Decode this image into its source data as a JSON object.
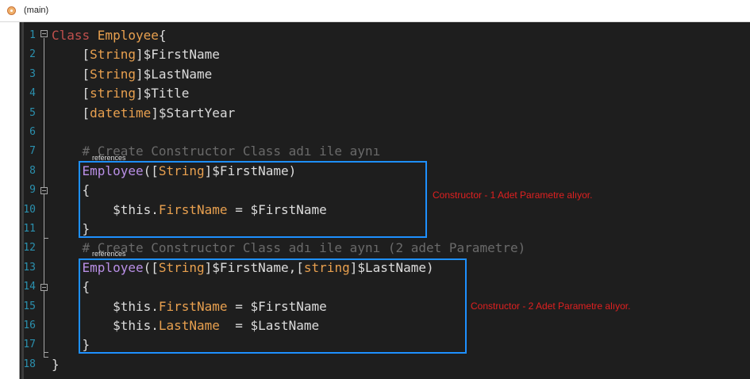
{
  "tab": {
    "icon": "powershell-script-icon",
    "label": "(main)"
  },
  "references_label": "references",
  "annotations": [
    {
      "text": "Constructor  - 1 Adet Parametre alıyor.",
      "color": "#e02020"
    },
    {
      "text": "Constructor  - 2 Adet Parametre alıyor.",
      "color": "#e02020"
    }
  ],
  "highlight_color": "#1e90ff",
  "lines": [
    {
      "n": "1",
      "tokens": [
        {
          "t": "Class ",
          "c": "kw"
        },
        {
          "t": "Employee",
          "c": "cls"
        },
        {
          "t": "{",
          "c": "bracket"
        }
      ]
    },
    {
      "n": "2",
      "tokens": [
        {
          "t": "    [",
          "c": "bracket"
        },
        {
          "t": "String",
          "c": "type"
        },
        {
          "t": "]",
          "c": "bracket"
        },
        {
          "t": "$FirstName",
          "c": "var"
        }
      ]
    },
    {
      "n": "3",
      "tokens": [
        {
          "t": "    [",
          "c": "bracket"
        },
        {
          "t": "String",
          "c": "type"
        },
        {
          "t": "]",
          "c": "bracket"
        },
        {
          "t": "$LastName",
          "c": "var"
        }
      ]
    },
    {
      "n": "4",
      "tokens": [
        {
          "t": "    [",
          "c": "bracket"
        },
        {
          "t": "string",
          "c": "type"
        },
        {
          "t": "]",
          "c": "bracket"
        },
        {
          "t": "$Title",
          "c": "var"
        }
      ]
    },
    {
      "n": "5",
      "tokens": [
        {
          "t": "    [",
          "c": "bracket"
        },
        {
          "t": "datetime",
          "c": "type"
        },
        {
          "t": "]",
          "c": "bracket"
        },
        {
          "t": "$StartYear",
          "c": "var"
        }
      ]
    },
    {
      "n": "6",
      "tokens": []
    },
    {
      "n": "7",
      "tokens": [
        {
          "t": "    # Create Constructor Class adı ile aynı",
          "c": "comment"
        }
      ]
    },
    {
      "n": "8",
      "tokens": [
        {
          "t": "    ",
          "c": "var"
        },
        {
          "t": "Employee",
          "c": "ctor"
        },
        {
          "t": "([",
          "c": "bracket"
        },
        {
          "t": "String",
          "c": "type"
        },
        {
          "t": "]",
          "c": "bracket"
        },
        {
          "t": "$FirstName",
          "c": "var"
        },
        {
          "t": ")",
          "c": "bracket"
        }
      ]
    },
    {
      "n": "9",
      "tokens": [
        {
          "t": "    {",
          "c": "bracket"
        }
      ]
    },
    {
      "n": "10",
      "tokens": [
        {
          "t": "        $this.",
          "c": "var"
        },
        {
          "t": "FirstName",
          "c": "prop"
        },
        {
          "t": " = $FirstName",
          "c": "var"
        }
      ]
    },
    {
      "n": "11",
      "tokens": [
        {
          "t": "    }",
          "c": "bracket"
        }
      ]
    },
    {
      "n": "12",
      "tokens": [
        {
          "t": "    # Create Constructor Class adı ile aynı (2 adet Parametre)",
          "c": "comment"
        }
      ]
    },
    {
      "n": "13",
      "tokens": [
        {
          "t": "    ",
          "c": "var"
        },
        {
          "t": "Employee",
          "c": "ctor"
        },
        {
          "t": "([",
          "c": "bracket"
        },
        {
          "t": "String",
          "c": "type"
        },
        {
          "t": "]",
          "c": "bracket"
        },
        {
          "t": "$FirstName,",
          "c": "var"
        },
        {
          "t": "[",
          "c": "bracket"
        },
        {
          "t": "string",
          "c": "type"
        },
        {
          "t": "]",
          "c": "bracket"
        },
        {
          "t": "$LastName",
          "c": "var"
        },
        {
          "t": ")",
          "c": "bracket"
        }
      ]
    },
    {
      "n": "14",
      "tokens": [
        {
          "t": "    {",
          "c": "bracket"
        }
      ]
    },
    {
      "n": "15",
      "tokens": [
        {
          "t": "        $this.",
          "c": "var"
        },
        {
          "t": "FirstName",
          "c": "prop"
        },
        {
          "t": " = $FirstName",
          "c": "var"
        }
      ]
    },
    {
      "n": "16",
      "tokens": [
        {
          "t": "        $this.",
          "c": "var"
        },
        {
          "t": "LastName",
          "c": "prop"
        },
        {
          "t": "  = $LastName",
          "c": "var"
        }
      ]
    },
    {
      "n": "17",
      "tokens": [
        {
          "t": "    }",
          "c": "bracket"
        }
      ]
    },
    {
      "n": "18",
      "tokens": [
        {
          "t": "}",
          "c": "bracket"
        }
      ]
    }
  ]
}
